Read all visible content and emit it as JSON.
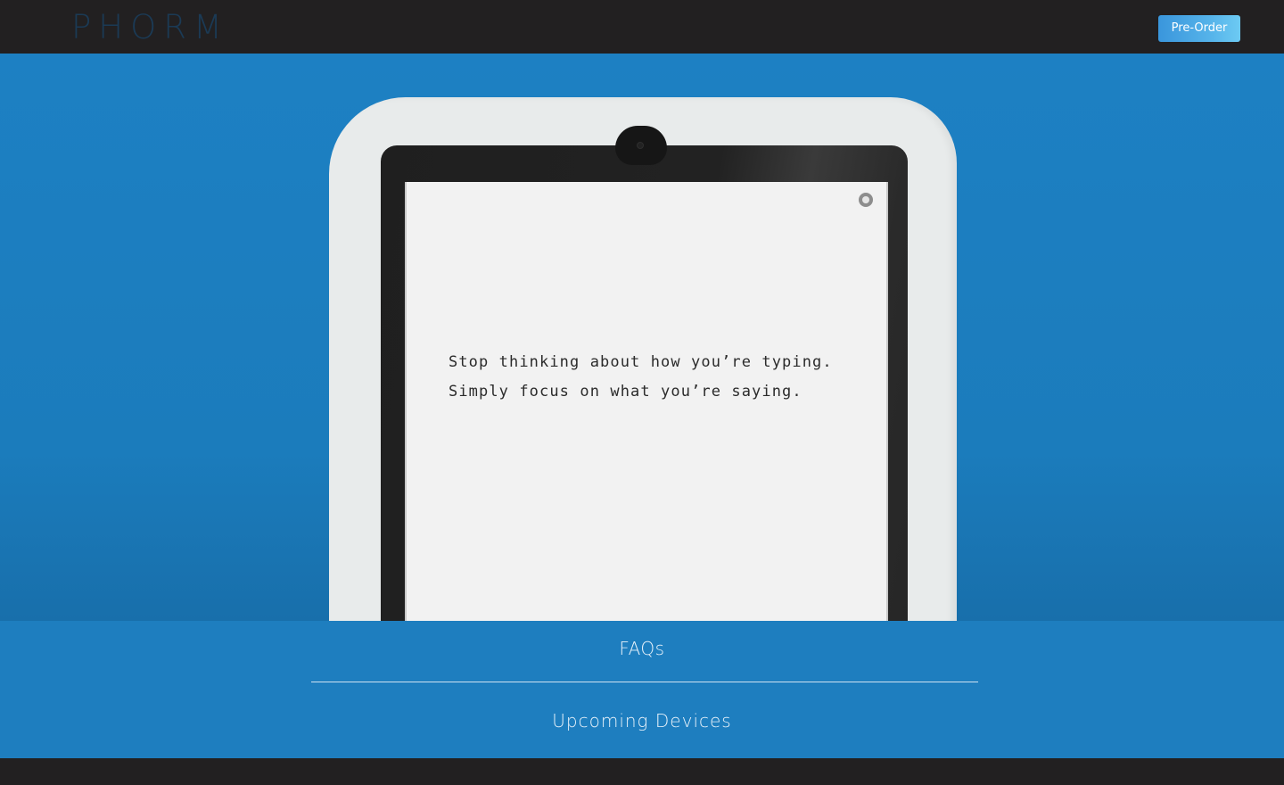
{
  "header": {
    "logo_text": "PHORM",
    "preorder_label": "Pre-Order"
  },
  "hero": {
    "screen_lines": [
      "Stop thinking about how you’re typing.",
      "Simply focus on what you’re saying."
    ],
    "screen_icon": "aperture-icon"
  },
  "links": {
    "faq_label": "FAQs",
    "devices_label": "Upcoming Devices"
  },
  "colors": {
    "accent_blue": "#1d80c3",
    "header_dark": "#222021",
    "logo_color": "#1b3a55",
    "button_gradient_start": "#3a96dc",
    "button_gradient_end": "#6dcaf3"
  }
}
